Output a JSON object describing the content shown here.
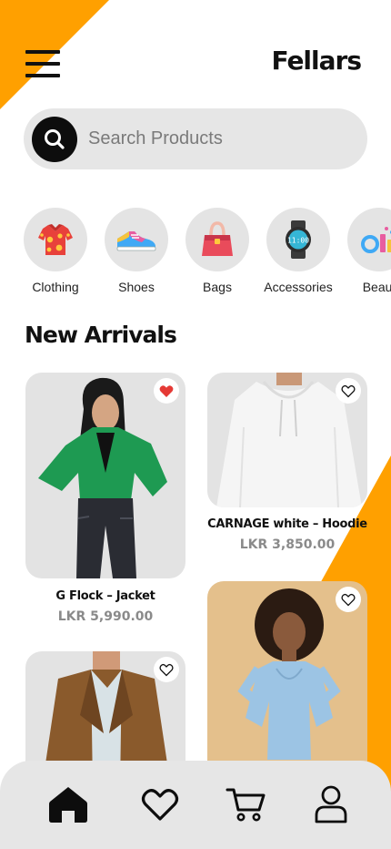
{
  "app": {
    "brand": "Fellars"
  },
  "search": {
    "placeholder": "Search Products"
  },
  "categories": [
    {
      "label": "Clothing",
      "icon": "shirt-icon"
    },
    {
      "label": "Shoes",
      "icon": "sneaker-icon"
    },
    {
      "label": "Bags",
      "icon": "handbag-icon"
    },
    {
      "label": "Accessories",
      "icon": "watch-icon"
    },
    {
      "label": "Beaut",
      "icon": "cosmetics-icon"
    }
  ],
  "section": {
    "title": "New Arrivals"
  },
  "products": [
    {
      "name": "G Flock – Jacket",
      "price": "LKR 5,990.00",
      "favorited": true
    },
    {
      "name": "CARNAGE white – Hoodie",
      "price": "LKR 3,850.00",
      "favorited": false
    },
    {
      "name": "",
      "price": "",
      "favorited": false
    },
    {
      "name": "",
      "price": "",
      "favorited": false
    }
  ],
  "nav": [
    "home-icon",
    "heart-icon",
    "cart-icon",
    "user-icon"
  ],
  "colors": {
    "accent": "#FFA000",
    "surface": "#E6E6E6",
    "favorite": "#E53935",
    "text": "#111111"
  }
}
